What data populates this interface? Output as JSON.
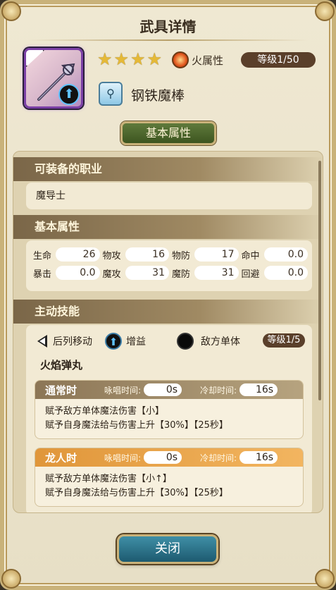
{
  "header": {
    "title": "武具详情"
  },
  "weapon": {
    "stars": 4,
    "element_label": "火属性",
    "element_icon": "fire-element-icon",
    "level_label": "等级1/50",
    "type_icon": "magnifier-staff-type-icon",
    "name": "钢铁魔棒"
  },
  "tab": {
    "label": "基本属性"
  },
  "equip_section": {
    "title": "可装备的职业",
    "job": "魔导士"
  },
  "stats_section": {
    "title": "基本属性",
    "stats": [
      {
        "label": "生命",
        "value": "26"
      },
      {
        "label": "物攻",
        "value": "16"
      },
      {
        "label": "物防",
        "value": "17"
      },
      {
        "label": "命中",
        "value": "0.0"
      },
      {
        "label": "暴击",
        "value": "0.0"
      },
      {
        "label": "魔攻",
        "value": "31"
      },
      {
        "label": "魔防",
        "value": "31"
      },
      {
        "label": "回避",
        "value": "0.0"
      }
    ]
  },
  "skill_section": {
    "title": "主动技能",
    "tag_move": "后列移动",
    "tag_buff": "增益",
    "tag_target": "敌方单体",
    "level_label": "等级1/5",
    "skill_name": "火焰弹丸",
    "modes": [
      {
        "name": "通常时",
        "cast_label": "咏唱时间:",
        "cast_value": "0s",
        "cooldown_label": "冷却时间:",
        "cooldown_value": "16s",
        "lines": [
          "赋予敌方单体魔法伤害【小】",
          "赋予自身魔法给与伤害上升【30%】【25秒】"
        ]
      },
      {
        "name": "龙人时",
        "cast_label": "咏唱时间:",
        "cast_value": "0s",
        "cooldown_label": "冷却时间:",
        "cooldown_value": "16s",
        "lines": [
          "赋予敌方单体魔法伤害【小↑】",
          "赋予自身魔法给与伤害上升【30%】【25秒】"
        ]
      }
    ]
  },
  "footer": {
    "close_label": "关闭"
  }
}
